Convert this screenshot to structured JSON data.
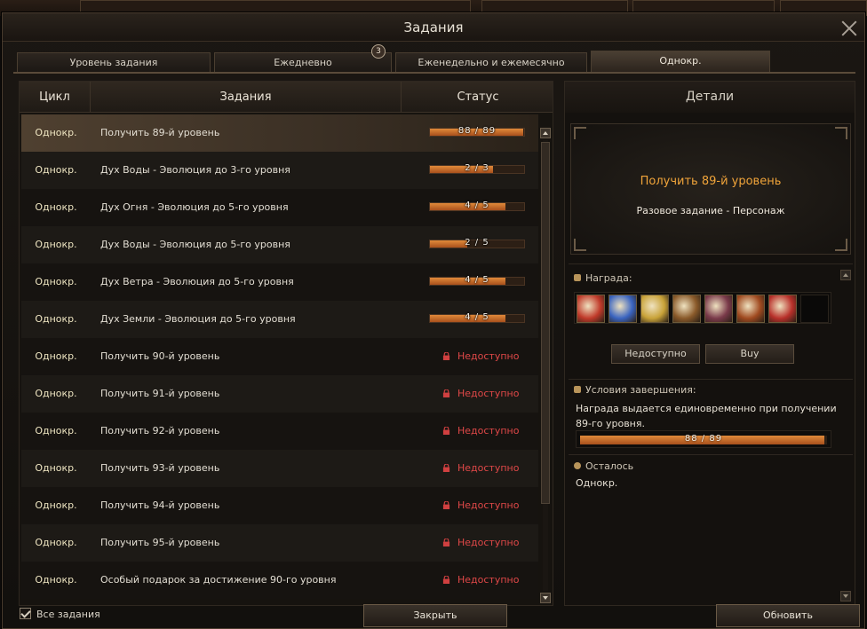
{
  "window": {
    "title": "Задания"
  },
  "tabs": [
    {
      "label": "Уровень задания"
    },
    {
      "label": "Ежедневно",
      "badge": "3"
    },
    {
      "label": "Еженедельно и ежемесячно"
    },
    {
      "label": "Однокр."
    }
  ],
  "list": {
    "headers": {
      "cycle": "Цикл",
      "task": "Задания",
      "status": "Статус"
    },
    "rows": [
      {
        "cycle": "Однокр.",
        "task": "Получить 89-й уровень",
        "progress_text": "88 / 89",
        "progress": 0.99,
        "locked": false
      },
      {
        "cycle": "Однокр.",
        "task": "Дух Воды - Эволюция до 3-го уровня",
        "progress_text": "2 / 3",
        "progress": 0.67,
        "locked": false
      },
      {
        "cycle": "Однокр.",
        "task": "Дух Огня - Эволюция до 5-го уровня",
        "progress_text": "4 / 5",
        "progress": 0.8,
        "locked": false
      },
      {
        "cycle": "Однокр.",
        "task": "Дух Воды - Эволюция до 5-го уровня",
        "progress_text": "2 / 5",
        "progress": 0.4,
        "locked": false
      },
      {
        "cycle": "Однокр.",
        "task": "Дух Ветра - Эволюция до 5-го уровня",
        "progress_text": "4 / 5",
        "progress": 0.8,
        "locked": false
      },
      {
        "cycle": "Однокр.",
        "task": "Дух Земли - Эволюция до 5-го уровня",
        "progress_text": "4 / 5",
        "progress": 0.8,
        "locked": false
      },
      {
        "cycle": "Однокр.",
        "task": "Получить 90-й уровень",
        "status_text": "Недоступно",
        "locked": true
      },
      {
        "cycle": "Однокр.",
        "task": "Получить 91-й уровень",
        "status_text": "Недоступно",
        "locked": true
      },
      {
        "cycle": "Однокр.",
        "task": "Получить 92-й уровень",
        "status_text": "Недоступно",
        "locked": true
      },
      {
        "cycle": "Однокр.",
        "task": "Получить 93-й уровень",
        "status_text": "Недоступно",
        "locked": true
      },
      {
        "cycle": "Однокр.",
        "task": "Получить 94-й уровень",
        "status_text": "Недоступно",
        "locked": true
      },
      {
        "cycle": "Однокр.",
        "task": "Получить 95-й уровень",
        "status_text": "Недоступно",
        "locked": true
      },
      {
        "cycle": "Однокр.",
        "task": "Особый подарок за достижение 90-го уровня",
        "status_text": "Недоступно",
        "locked": true
      }
    ]
  },
  "details": {
    "heading": "Детали",
    "quest_title": "Получить 89-й уровень",
    "quest_type": "Разовое задание  -  Персонаж",
    "reward_label": "Награда:",
    "rewards": [
      {
        "icon": "scroll-red-icon",
        "color": "#c03a2a"
      },
      {
        "icon": "scroll-blue-icon",
        "color": "#3a64c0"
      },
      {
        "icon": "exp-scroll-icon",
        "color": "#c8a238"
      },
      {
        "icon": "scroll-brown-icon",
        "color": "#8a5a2a"
      },
      {
        "icon": "book-icon",
        "color": "#7a3a4a"
      },
      {
        "icon": "tome-icon",
        "color": "#a04a20"
      },
      {
        "icon": "potion-icon",
        "color": "#b8302a"
      }
    ],
    "unavailable_button": "Недоступно",
    "buy_button": "Buy",
    "conditions_label": "Условия завершения:",
    "conditions_text": "Награда выдается единовременно при получении 89-го уровня.",
    "conditions_progress_text": "88 / 89",
    "conditions_progress": 0.99,
    "remaining_label": "Осталось",
    "remaining_value": "Однокр."
  },
  "footer": {
    "all_tasks_label": "Все задания",
    "all_tasks_checked": true,
    "close_button": "Закрыть",
    "refresh_button": "Обновить"
  }
}
